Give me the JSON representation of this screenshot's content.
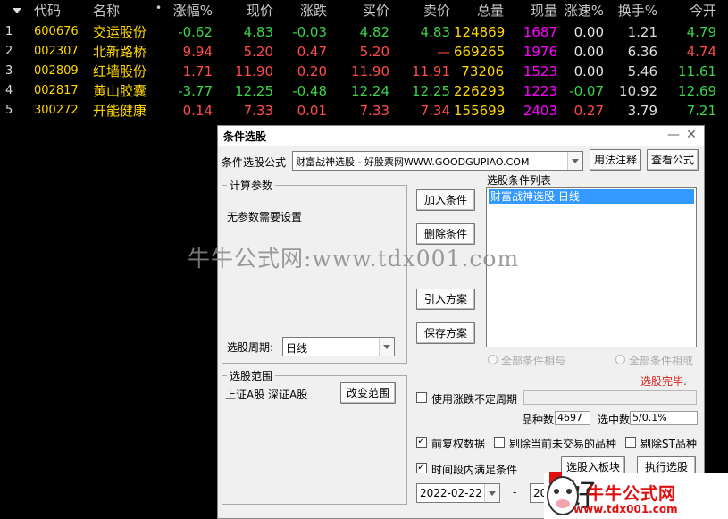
{
  "table": {
    "headers": {
      "code": "代码",
      "name": "名称",
      "dot": "•",
      "chg_pct": "涨幅%",
      "price": "现价",
      "diff": "涨跌",
      "bid": "买价",
      "ask": "卖价",
      "volume": "总量",
      "cur_vol": "现量",
      "speed": "涨速%",
      "turnover": "换手%",
      "open": "今开"
    },
    "rows": [
      {
        "no": "1",
        "code": "600676",
        "name": "交运股份",
        "chg_pct": "-0.62",
        "price": "4.83",
        "diff": "-0.03",
        "bid": "4.82",
        "ask": "4.83",
        "volume": "124869",
        "cur_vol": "1687",
        "speed": "0.00",
        "turnover": "1.21",
        "open": "4.79"
      },
      {
        "no": "2",
        "code": "002307",
        "name": "北新路桥",
        "chg_pct": "9.94",
        "price": "5.20",
        "diff": "0.47",
        "bid": "5.20",
        "ask": "—",
        "volume": "669265",
        "cur_vol": "1976",
        "speed": "0.00",
        "turnover": "6.36",
        "open": "4.74"
      },
      {
        "no": "3",
        "code": "002809",
        "name": "红墙股份",
        "chg_pct": "1.71",
        "price": "11.90",
        "diff": "0.20",
        "bid": "11.90",
        "ask": "11.91",
        "volume": "73206",
        "cur_vol": "1523",
        "speed": "0.00",
        "turnover": "5.46",
        "open": "11.61"
      },
      {
        "no": "4",
        "code": "002817",
        "name": "黄山胶囊",
        "chg_pct": "-3.77",
        "price": "12.25",
        "diff": "-0.48",
        "bid": "12.24",
        "ask": "12.25",
        "volume": "226293",
        "cur_vol": "1223",
        "speed": "-0.07",
        "turnover": "10.92",
        "open": "12.69"
      },
      {
        "no": "5",
        "code": "300272",
        "name": "开能健康",
        "chg_pct": "0.14",
        "price": "7.33",
        "diff": "0.01",
        "bid": "7.33",
        "ask": "7.34",
        "volume": "155699",
        "cur_vol": "2403",
        "speed": "0.27",
        "turnover": "3.79",
        "open": "7.21"
      }
    ]
  },
  "colors": {
    "up": "#ff4b4b",
    "down": "#3cd24a",
    "flat": "#e6e6e6",
    "volume": "#ffd700",
    "cur_vol": "#ff00ff"
  },
  "watermark": "牛牛公式网:www.tdx001.com",
  "dialog": {
    "title": "条件选股",
    "formula_label": "条件选股公式",
    "formula_value": "财富战神选股 - 好股票网WWW.GOODGUPIAO.COM",
    "usage_button": "用法注释",
    "view_formula_button": "查看公式",
    "params_group": "计算参数",
    "params_text": "无参数需要设置",
    "period_label": "选股周期:",
    "period_value": "日线",
    "add_button": "加入条件",
    "delete_button": "删除条件",
    "import_button": "引入方案",
    "save_button": "保存方案",
    "list_label": "选股条件列表",
    "list_items": [
      "财富战神选股  日线"
    ],
    "radio_and": "全部条件相与",
    "radio_or": "全部条件相或",
    "status": "选股完毕.",
    "range_group": "选股范围",
    "range_text": "上证A股 深证A股",
    "change_range_button": "改变范围",
    "uncertain_period_label": "使用涨跌不定周期",
    "variety_label": "品种数",
    "variety_value": "4697",
    "selected_label": "选中数",
    "selected_value": "5/0.1%",
    "pre_adjust_label": "前复权数据",
    "exclude_untraded_label": "剔除当前未交易的品种",
    "exclude_st_label": "剔除ST品种",
    "time_range_label": "时间段内满足条件",
    "to_block_button": "选股入板块",
    "execute_button": "执行选股",
    "start_date": "2022-02-22",
    "date_sep": "-",
    "end_date": "202"
  },
  "logo": {
    "brand_char": "好",
    "badge_text": "牛牛公式网",
    "badge_url": "www.tdx001.com"
  }
}
